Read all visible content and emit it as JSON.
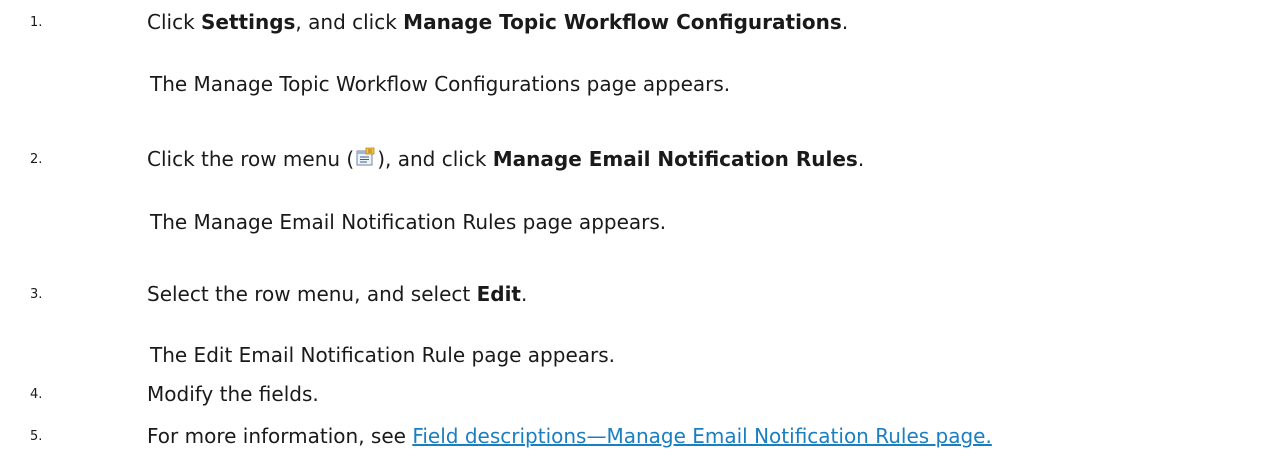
{
  "steps": [
    {
      "number": "1.",
      "parts": [
        "Click ",
        "Settings",
        ", and click ",
        "Manage Topic Workflow Configurations",
        "."
      ],
      "result": "The Manage Topic Workflow Configurations page appears."
    },
    {
      "number": "2.",
      "parts": [
        "Click the row menu (",
        "), and click ",
        "Manage Email Notification Rules",
        "."
      ],
      "icon": "row-menu-icon",
      "result": "The Manage Email Notification Rules page appears."
    },
    {
      "number": "3.",
      "parts": [
        "Select the row menu, and select ",
        "Edit",
        "."
      ],
      "result": "The Edit Email Notification Rule page appears."
    },
    {
      "number": "4.",
      "parts": [
        "Modify the fields."
      ]
    },
    {
      "number": "5.",
      "parts": [
        "For more information, see ",
        "Field descriptions—Manage Email Notification Rules page."
      ]
    }
  ],
  "colors": {
    "link": "#1a7fc1",
    "text": "#1a1a1a"
  }
}
